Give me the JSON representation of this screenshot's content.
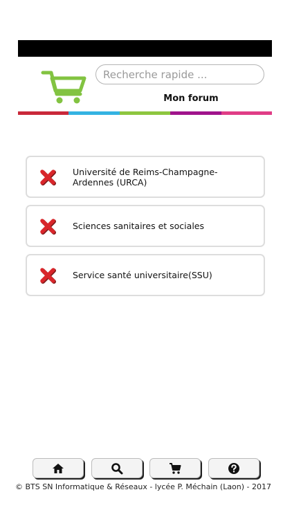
{
  "header": {
    "logo_icon": "shopping-cart-icon",
    "search": {
      "placeholder": "Recherche rapide ...",
      "value": ""
    },
    "forum_label": "Mon forum",
    "stripe_colors": [
      "#c9283a",
      "#34b3e2",
      "#8dc63f",
      "#a0148c",
      "#e03d86"
    ]
  },
  "items": [
    {
      "label": "Université de Reims-Champagne-Ardennes (URCA)",
      "icon": "red-x-icon"
    },
    {
      "label": "Sciences sanitaires et sociales",
      "icon": "red-x-icon"
    },
    {
      "label": "Service santé universitaire(SSU)",
      "icon": "red-x-icon"
    }
  ],
  "footer": {
    "nav": [
      {
        "icon": "home-icon"
      },
      {
        "icon": "search-icon"
      },
      {
        "icon": "cart-icon"
      },
      {
        "icon": "help-icon"
      }
    ],
    "copyright": "© BTS SN Informatique & Réseaux - lycée P. Méchain (Laon) - 2017"
  }
}
